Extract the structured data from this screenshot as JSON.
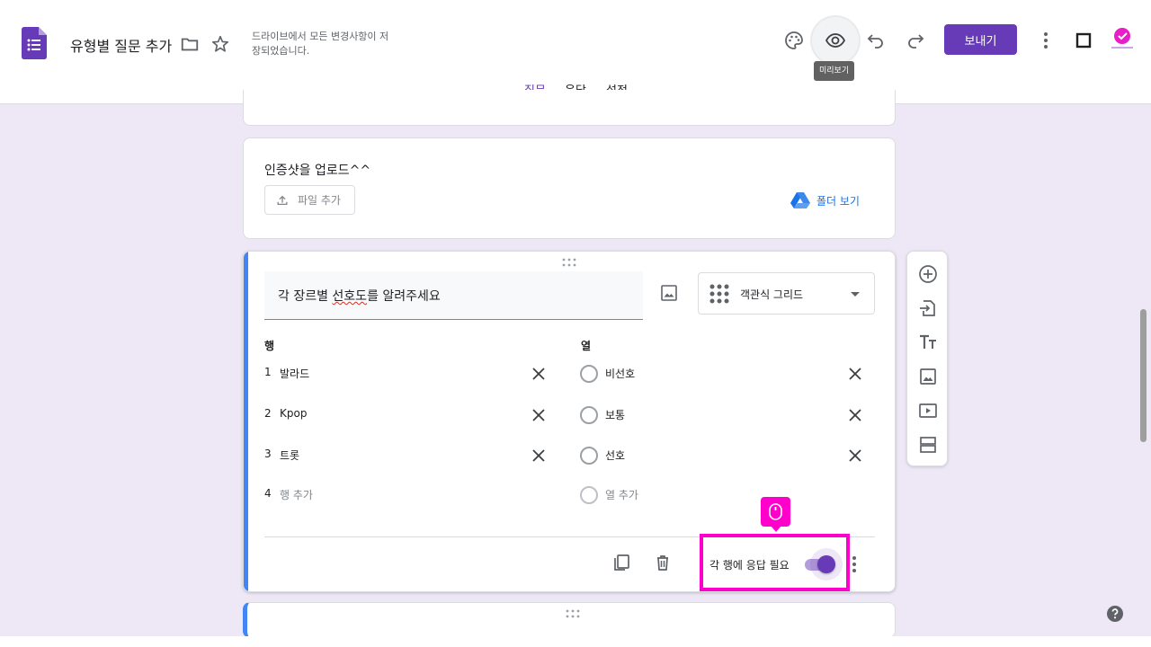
{
  "header": {
    "doc_title": "유형별 질문 추가",
    "save_status": "드라이브에서 모든 변경사항이 저장되었습니다.",
    "preview_tooltip": "미리보기",
    "send_label": "보내기"
  },
  "tabs": [
    {
      "label": "질문",
      "active": true
    },
    {
      "label": "응답",
      "active": false
    },
    {
      "label": "설정",
      "active": false
    }
  ],
  "upload_card": {
    "title": "인증샷을 업로드^^",
    "file_button": "파일 추가",
    "folder_link": "폴더 보기"
  },
  "question_card": {
    "title_prefix": "각 장르별 ",
    "title_misspelled": "선호도",
    "title_suffix": "를 알려주세요",
    "type_label": "객관식 그리드",
    "rows_header": "행",
    "cols_header": "열",
    "rows": [
      {
        "num": "1",
        "label": "발라드"
      },
      {
        "num": "2",
        "label": "Kpop"
      },
      {
        "num": "3",
        "label": "트롯"
      }
    ],
    "add_row": {
      "num": "4",
      "label": "행 추가"
    },
    "columns": [
      {
        "label": "비선호"
      },
      {
        "label": "보통"
      },
      {
        "label": "선호"
      }
    ],
    "add_column": "열 추가",
    "required_label": "각 행에 응답 필요",
    "required_on": true
  },
  "colors": {
    "accent": "#673ab7",
    "highlight": "#ff00cc",
    "link": "#1a73e8",
    "card_accent": "#4285f4"
  }
}
